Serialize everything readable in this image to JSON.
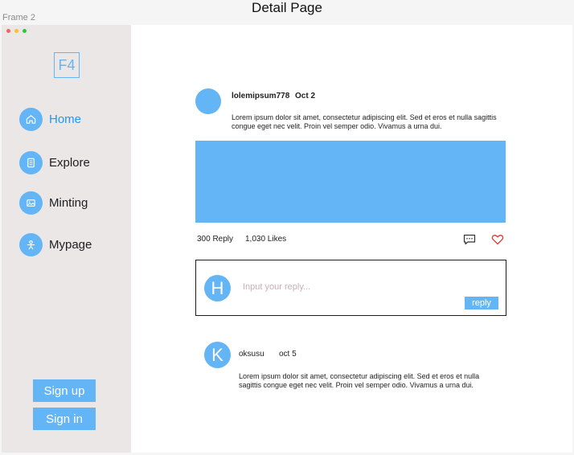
{
  "frame": {
    "label": "Frame 2"
  },
  "page": {
    "title": "Detail Page"
  },
  "window": {
    "dots": [
      "#ff5f57",
      "#febc2e",
      "#28c840"
    ]
  },
  "colors": {
    "accent": "#64b5f6",
    "sidebar_bg": "#ebe7e6",
    "like": "#e53935"
  },
  "sidebar": {
    "logo": "F4",
    "items": [
      {
        "label": "Home",
        "icon": "home-icon",
        "active": true
      },
      {
        "label": "Explore",
        "icon": "document-icon",
        "active": false
      },
      {
        "label": "Minting",
        "icon": "image-icon",
        "active": false
      },
      {
        "label": "Mypage",
        "icon": "person-icon",
        "active": false
      }
    ],
    "signup_label": "Sign up",
    "signin_label": "Sign in"
  },
  "post": {
    "author": "lolemipsum778",
    "date": "Oct 2",
    "body": "Lorem ipsum dolor sit amet, consectetur adipiscing elit. Sed et eros et nulla sagittis congue eget nec velit. Proin vel semper odio. Vivamus a urna dui.",
    "reply_count": "300 Reply",
    "likes": "1,030 Likes"
  },
  "reply_form": {
    "avatar_letter": "H",
    "placeholder": "Input your reply...",
    "button_label": "reply"
  },
  "comments": [
    {
      "avatar_letter": "K",
      "author": "oksusu",
      "date": "oct 5",
      "body": "Lorem ipsum dolor sit amet, consectetur adipiscing elit. Sed et eros et nulla sagittis congue eget nec velit. Proin vel semper odio. Vivamus a urna dui."
    }
  ]
}
